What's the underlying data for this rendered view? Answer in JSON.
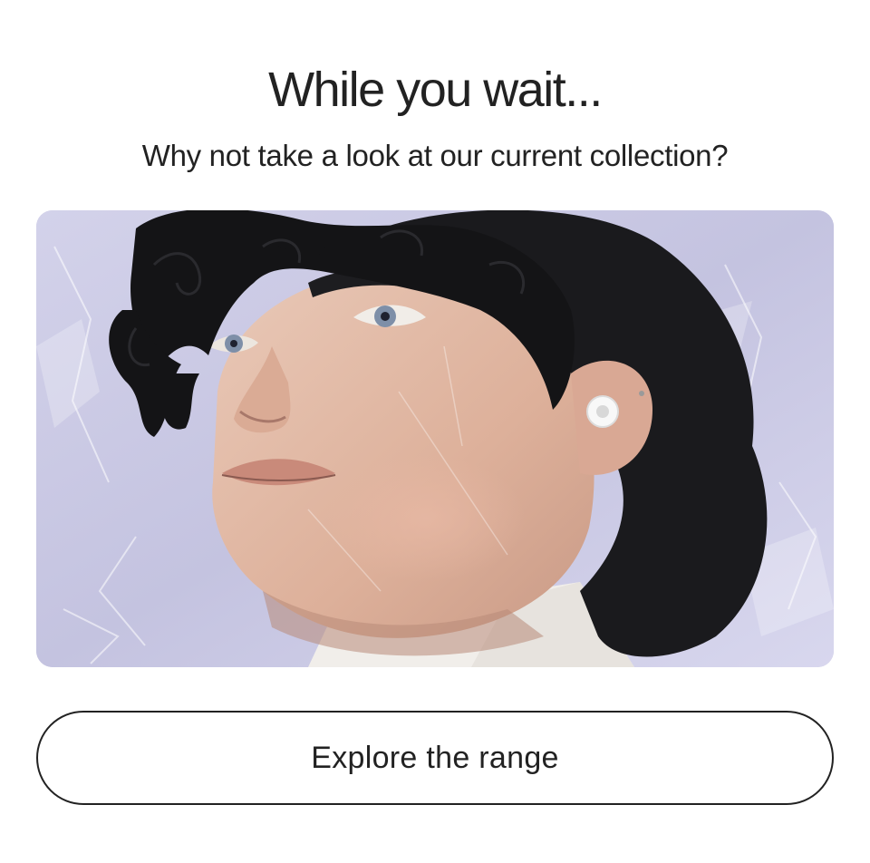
{
  "dialog": {
    "title": "While you wait...",
    "subtitle": "Why not take a look at our current collection?",
    "hero_image": {
      "subject": "model-wearing-white-earbud",
      "background_color": "#c9c8e4"
    },
    "cta_label": "Explore the range"
  }
}
